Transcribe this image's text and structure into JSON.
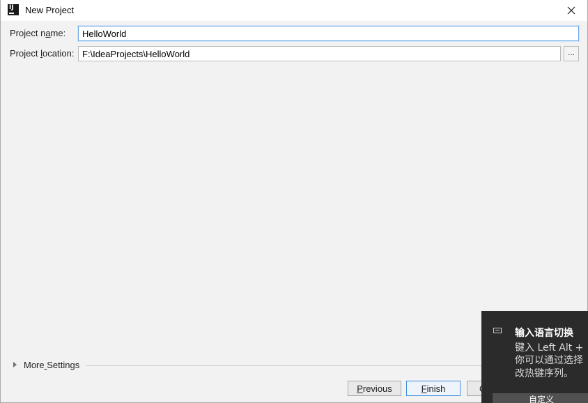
{
  "window": {
    "title": "New Project",
    "close_symbol": "×"
  },
  "form": {
    "project_name_label_pre": "Project n",
    "project_name_label_mn": "a",
    "project_name_label_post": "me:",
    "project_name_value": "HelloWorld",
    "project_location_label_pre": "Project ",
    "project_location_label_mn": "l",
    "project_location_label_post": "ocation:",
    "project_location_value": "F:\\IdeaProjects\\HelloWorld",
    "browse_label": "..."
  },
  "more_settings": {
    "label_pre": "More",
    "label_mn": " ",
    "label_post": "Settings"
  },
  "buttons": {
    "previous_mn": "P",
    "previous_rest": "revious",
    "finish_mn": "F",
    "finish_rest": "inish",
    "cancel_partial": "C"
  },
  "ime_toast": {
    "icon": "keyboard-icon",
    "title": "输入语言切换",
    "line1": "键入 Left Alt +",
    "line2": "你可以通过选择",
    "line3": "改热键序列。",
    "button_label": "自定义"
  },
  "colors": {
    "accent": "#3d8ee0",
    "toast_bg": "#2b2b2b"
  }
}
